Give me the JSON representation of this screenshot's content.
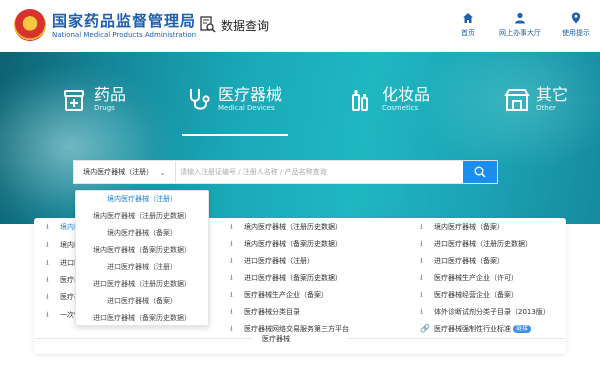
{
  "header": {
    "title_cn": "国家药品监督管理局",
    "title_en": "National Medical Products Administration",
    "query_label": "数据查询",
    "nav": [
      {
        "label": "首页",
        "icon": "home-icon"
      },
      {
        "label": "网上办事大厅",
        "icon": "user-icon"
      },
      {
        "label": "使用提示",
        "icon": "location-pin-icon"
      }
    ]
  },
  "categories": [
    {
      "cn": "药品",
      "en": "Drugs",
      "icon": "drug-box-icon"
    },
    {
      "cn": "医疗器械",
      "en": "Medical Devices",
      "icon": "stethoscope-icon",
      "active": true
    },
    {
      "cn": "化妆品",
      "en": "Cosmetics",
      "icon": "cosmetics-bottles-icon"
    },
    {
      "cn": "其它",
      "en": "Other",
      "icon": "shop-icon"
    }
  ],
  "search": {
    "selected": "境内医疗器械（注册）",
    "placeholder": "请输入注册证编号 / 注册人名称 / 产品名称查询"
  },
  "dropdown": {
    "options": [
      "境内医疗器械（注册）",
      "境内医疗器械（注册历史数据）",
      "境内医疗器械（备案）",
      "境内医疗器械（备案历史数据）",
      "进口医疗器械（注册）",
      "进口医疗器械（注册历史数据）",
      "进口医疗器械（备案）",
      "进口医疗器械（备案历史数据）"
    ]
  },
  "links": {
    "col1": [
      "境内医",
      "境内医",
      "进口医",
      "医疗器",
      "医疗器",
      "一次性"
    ],
    "col2": [
      "境内医疗器械（注册历史数据）",
      "境内医疗器械（备案历史数据）",
      "进口医疗器械（注册）",
      "进口医疗器械（备案历史数据）",
      "医疗器械生产企业（备案）",
      "医疗器械分类目录",
      "医疗器械网络交易服务第三方平台"
    ],
    "col3": [
      "境内医疗器械（备案）",
      "进口医疗器械（注册历史数据）",
      "进口医疗器械（备案）",
      "医疗器械生产企业（许可）",
      "医疗器械经营企业（备案）",
      "体外诊断试剂分类子目录（2013版）",
      "医疗器械强制性行业标准"
    ],
    "badge": "链接"
  },
  "section_title": "医疗器械",
  "colors": {
    "brand_blue": "#1d5fae",
    "accent_blue": "#1b8ef0",
    "teal": "#1aa9b8"
  }
}
